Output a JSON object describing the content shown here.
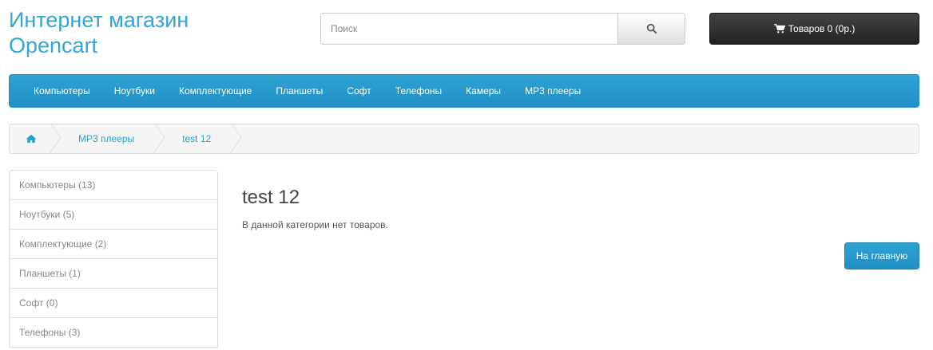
{
  "header": {
    "logo_line1": "Интернет магазин",
    "logo_line2": "Opencart",
    "search_placeholder": "Поиск",
    "search_icon": "search-icon",
    "cart_icon": "shopping-cart-icon",
    "cart_label": "Товаров 0 (0р.)"
  },
  "nav": {
    "items": [
      {
        "label": "Компьютеры"
      },
      {
        "label": "Ноутбуки"
      },
      {
        "label": "Комплектующие"
      },
      {
        "label": "Планшеты"
      },
      {
        "label": "Софт"
      },
      {
        "label": "Телефоны"
      },
      {
        "label": "Камеры"
      },
      {
        "label": "MP3 плееры"
      }
    ]
  },
  "breadcrumb": {
    "home_icon": "home-icon",
    "items": [
      {
        "label": "MP3 плееры"
      },
      {
        "label": "test 12"
      }
    ]
  },
  "sidebar": {
    "items": [
      {
        "label": "Компьютеры (13)"
      },
      {
        "label": "Ноутбуки (5)"
      },
      {
        "label": "Комплектующие (2)"
      },
      {
        "label": "Планшеты (1)"
      },
      {
        "label": "Софт (0)"
      },
      {
        "label": "Телефоны (3)"
      }
    ]
  },
  "content": {
    "title": "test 12",
    "empty_message": "В данной категории нет товаров.",
    "home_button": "На главную"
  },
  "colors": {
    "accent": "#23a1d1",
    "nav_bg": "#229ac8",
    "cart_bg": "#363636"
  }
}
